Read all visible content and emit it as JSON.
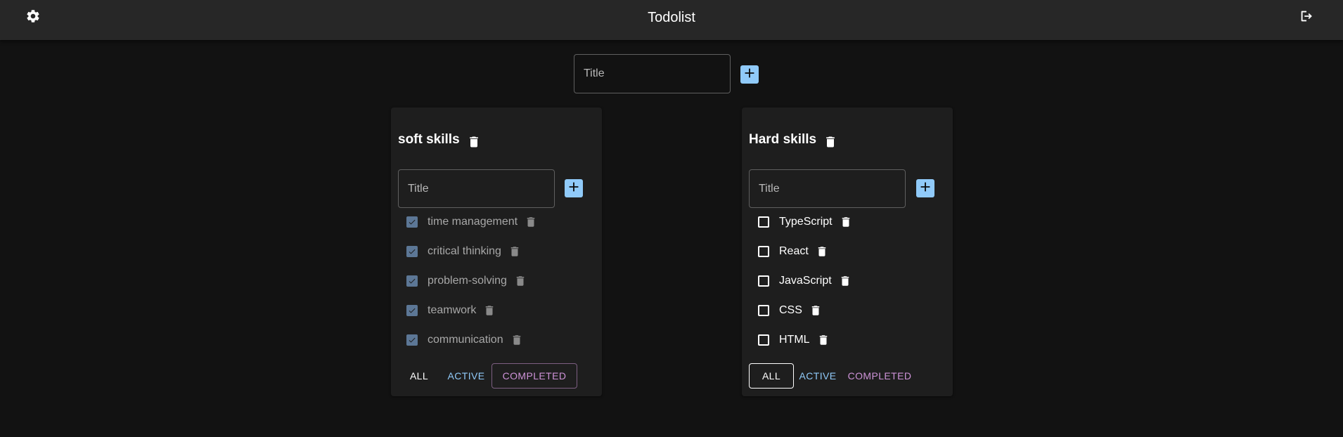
{
  "header": {
    "title": "Todolist",
    "settings_icon": "gear-icon",
    "logout_icon": "logout-icon"
  },
  "new_list": {
    "placeholder": "Title"
  },
  "colors": {
    "add_button": "#90caf9",
    "active_filter": "#90caf9",
    "completed_filter": "#ce93d8",
    "checked_box": "#5c7796"
  },
  "lists": [
    {
      "title": "soft skills",
      "task_placeholder": "Title",
      "filter": "completed",
      "tasks": [
        {
          "label": "time management",
          "done": true
        },
        {
          "label": "critical thinking",
          "done": true
        },
        {
          "label": "problem-solving",
          "done": true
        },
        {
          "label": "teamwork",
          "done": true
        },
        {
          "label": "communication",
          "done": true
        }
      ],
      "filters": {
        "all": "ALL",
        "active": "ACTIVE",
        "completed": "COMPLETED"
      }
    },
    {
      "title": "Hard skills",
      "task_placeholder": "Title",
      "filter": "all",
      "tasks": [
        {
          "label": "TypeScript",
          "done": false
        },
        {
          "label": "React",
          "done": false
        },
        {
          "label": "JavaScript",
          "done": false
        },
        {
          "label": "CSS",
          "done": false
        },
        {
          "label": "HTML",
          "done": false
        }
      ],
      "filters": {
        "all": "ALL",
        "active": "ACTIVE",
        "completed": "COMPLETED"
      }
    }
  ]
}
